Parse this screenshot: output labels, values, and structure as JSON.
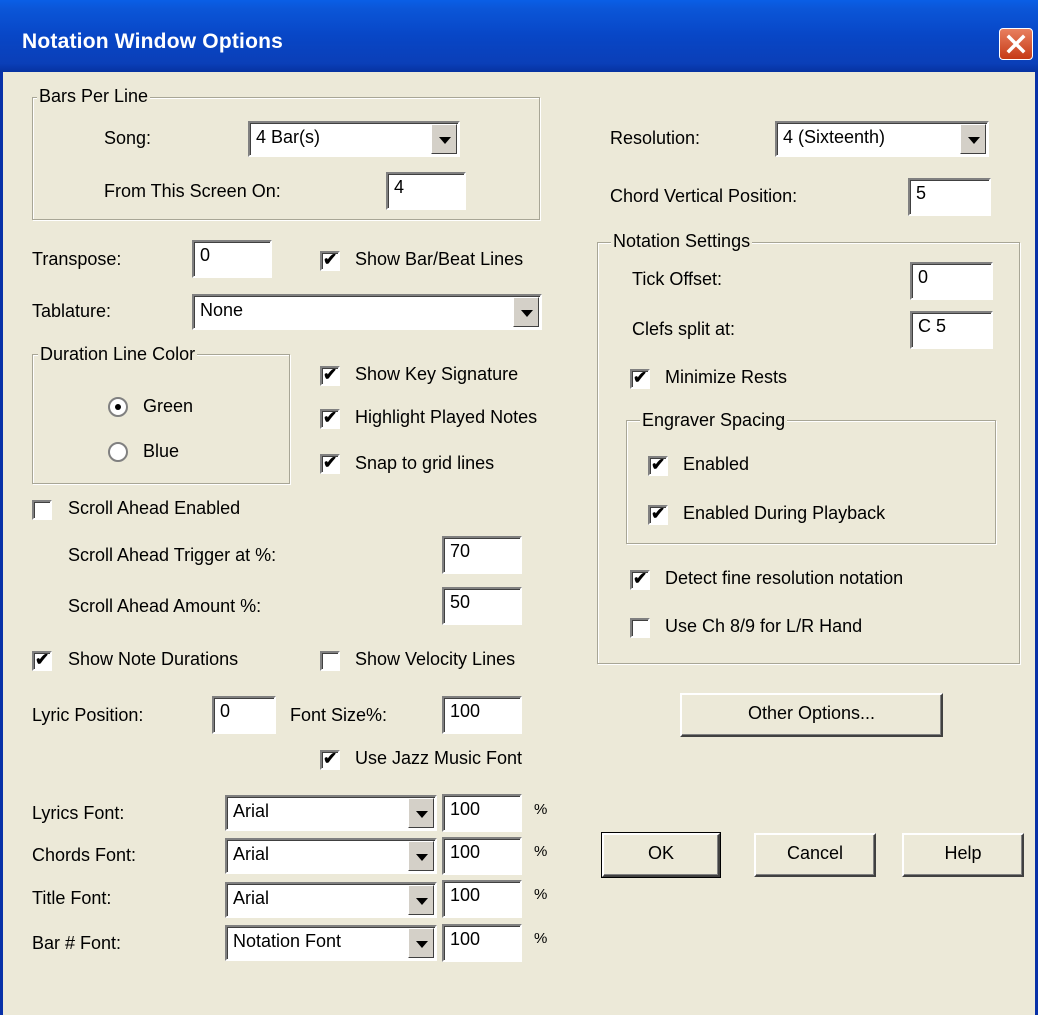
{
  "window": {
    "title": "Notation Window Options"
  },
  "bars_per_line": {
    "legend": "Bars Per Line",
    "song_label": "Song:",
    "song_value": "4 Bar(s)",
    "from_screen_label": "From This Screen On:",
    "from_screen_value": "4"
  },
  "resolution": {
    "label": "Resolution:",
    "value": "4 (Sixteenth)"
  },
  "chord_vertical": {
    "label": "Chord Vertical Position:",
    "value": "5"
  },
  "transpose": {
    "label": "Transpose:",
    "value": "0"
  },
  "show_bar_beat": {
    "label": "Show Bar/Beat Lines",
    "checked": true
  },
  "tablature": {
    "label": "Tablature:",
    "value": "None"
  },
  "duration_color": {
    "legend": "Duration Line Color",
    "green": "Green",
    "blue": "Blue",
    "selected": "Green"
  },
  "show_key_sig": {
    "label": "Show Key Signature",
    "checked": true
  },
  "highlight_played": {
    "label": "Highlight Played Notes",
    "checked": true
  },
  "snap_grid": {
    "label": "Snap to grid lines",
    "checked": true
  },
  "scroll_ahead": {
    "enabled_label": "Scroll Ahead Enabled",
    "enabled": false,
    "trigger_label": "Scroll Ahead Trigger at %:",
    "trigger_value": "70",
    "amount_label": "Scroll Ahead Amount %:",
    "amount_value": "50"
  },
  "show_note_durations": {
    "label": "Show Note Durations",
    "checked": true
  },
  "show_velocity": {
    "label": "Show Velocity Lines",
    "checked": false
  },
  "lyric_position": {
    "label": "Lyric Position:",
    "value": "0"
  },
  "font_size": {
    "label": "Font Size%:",
    "value": "100"
  },
  "jazz_font": {
    "label": "Use Jazz Music Font",
    "checked": true
  },
  "fonts": [
    {
      "label": "Lyrics Font:",
      "font": "Arial",
      "size": "100",
      "unit": "%"
    },
    {
      "label": "Chords Font:",
      "font": "Arial",
      "size": "100",
      "unit": "%"
    },
    {
      "label": "Title Font:",
      "font": "Arial",
      "size": "100",
      "unit": "%"
    },
    {
      "label": "Bar # Font:",
      "font": "Notation Font",
      "size": "100",
      "unit": "%"
    }
  ],
  "notation_settings": {
    "legend": "Notation Settings",
    "tick_offset_label": "Tick Offset:",
    "tick_offset_value": "0",
    "clefs_split_label": "Clefs split at:",
    "clefs_split_value": "C 5",
    "minimize_rests_label": "Minimize Rests",
    "minimize_rests": true,
    "engraver_legend": "Engraver Spacing",
    "engraver_enabled_label": "Enabled",
    "engraver_enabled": true,
    "engraver_playback_label": "Enabled During Playback",
    "engraver_playback": true,
    "detect_fine_label": "Detect fine resolution notation",
    "detect_fine": true,
    "use_ch_label": "Use Ch 8/9 for L/R Hand",
    "use_ch": false
  },
  "buttons": {
    "other_options": "Other Options...",
    "ok": "OK",
    "cancel": "Cancel",
    "help": "Help"
  }
}
